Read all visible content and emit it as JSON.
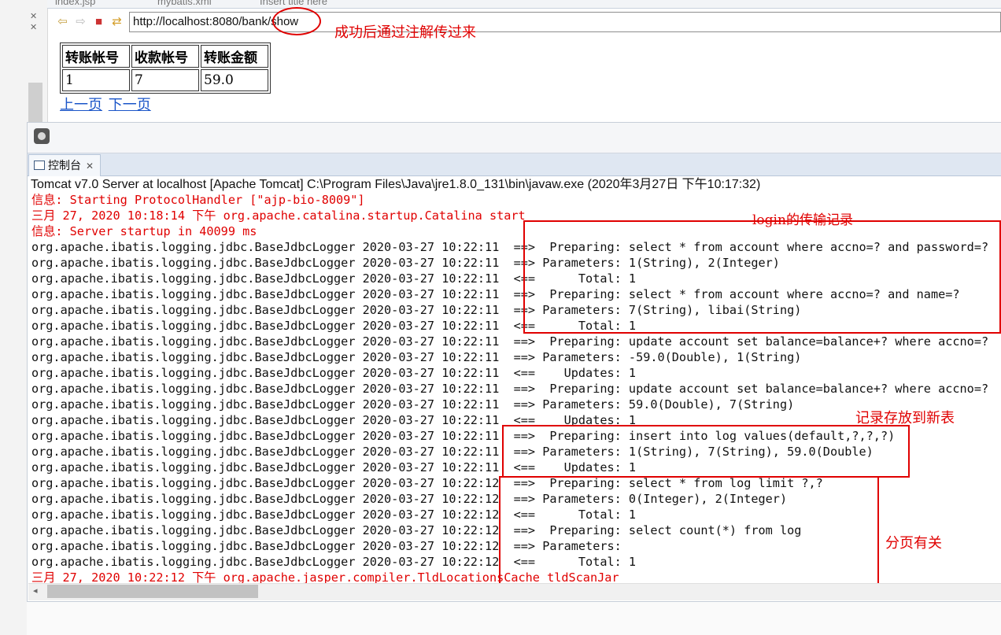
{
  "editor_tabs": [
    "index.jsp",
    "mybatis.xml",
    "Insert title here"
  ],
  "browser": {
    "url": "http://localhost:8080/bank/show",
    "url_note": "成功后通过注解传过来"
  },
  "page_table": {
    "headers": [
      "转账帐号",
      "收款帐号",
      "转账金额"
    ],
    "row": [
      "1",
      "7",
      "59.0"
    ]
  },
  "pager": {
    "prev": "上一页",
    "next": "下一页"
  },
  "console": {
    "tab_label": "控制台",
    "tab_close": "✕",
    "server_line": "Tomcat v7.0 Server at localhost [Apache Tomcat] C:\\Program Files\\Java\\jre1.8.0_131\\bin\\javaw.exe  (2020年3月27日 下午10:17:32)",
    "lines": [
      {
        "c": "red",
        "t": "信息: Starting ProtocolHandler [\"ajp-bio-8009\"]"
      },
      {
        "c": "red",
        "t": "三月 27, 2020 10:18:14 下午 org.apache.catalina.startup.Catalina start"
      },
      {
        "c": "red",
        "t": "信息: Server startup in 40099 ms"
      },
      {
        "c": "blk",
        "t": "org.apache.ibatis.logging.jdbc.BaseJdbcLogger 2020-03-27 10:22:11  ==>  Preparing: select * from account where accno=? and password=?"
      },
      {
        "c": "blk",
        "t": "org.apache.ibatis.logging.jdbc.BaseJdbcLogger 2020-03-27 10:22:11  ==> Parameters: 1(String), 2(Integer)"
      },
      {
        "c": "blk",
        "t": "org.apache.ibatis.logging.jdbc.BaseJdbcLogger 2020-03-27 10:22:11  <==      Total: 1"
      },
      {
        "c": "blk",
        "t": "org.apache.ibatis.logging.jdbc.BaseJdbcLogger 2020-03-27 10:22:11  ==>  Preparing: select * from account where accno=? and name=?"
      },
      {
        "c": "blk",
        "t": "org.apache.ibatis.logging.jdbc.BaseJdbcLogger 2020-03-27 10:22:11  ==> Parameters: 7(String), libai(String)"
      },
      {
        "c": "blk",
        "t": "org.apache.ibatis.logging.jdbc.BaseJdbcLogger 2020-03-27 10:22:11  <==      Total: 1"
      },
      {
        "c": "blk",
        "t": "org.apache.ibatis.logging.jdbc.BaseJdbcLogger 2020-03-27 10:22:11  ==>  Preparing: update account set balance=balance+? where accno=?"
      },
      {
        "c": "blk",
        "t": "org.apache.ibatis.logging.jdbc.BaseJdbcLogger 2020-03-27 10:22:11  ==> Parameters: -59.0(Double), 1(String)"
      },
      {
        "c": "blk",
        "t": "org.apache.ibatis.logging.jdbc.BaseJdbcLogger 2020-03-27 10:22:11  <==    Updates: 1"
      },
      {
        "c": "blk",
        "t": "org.apache.ibatis.logging.jdbc.BaseJdbcLogger 2020-03-27 10:22:11  ==>  Preparing: update account set balance=balance+? where accno=?"
      },
      {
        "c": "blk",
        "t": "org.apache.ibatis.logging.jdbc.BaseJdbcLogger 2020-03-27 10:22:11  ==> Parameters: 59.0(Double), 7(String)"
      },
      {
        "c": "blk",
        "t": "org.apache.ibatis.logging.jdbc.BaseJdbcLogger 2020-03-27 10:22:11  <==    Updates: 1"
      },
      {
        "c": "blk",
        "t": "org.apache.ibatis.logging.jdbc.BaseJdbcLogger 2020-03-27 10:22:11  ==>  Preparing: insert into log values(default,?,?,?)"
      },
      {
        "c": "blk",
        "t": "org.apache.ibatis.logging.jdbc.BaseJdbcLogger 2020-03-27 10:22:11  ==> Parameters: 1(String), 7(String), 59.0(Double)"
      },
      {
        "c": "blk",
        "t": "org.apache.ibatis.logging.jdbc.BaseJdbcLogger 2020-03-27 10:22:11  <==    Updates: 1"
      },
      {
        "c": "blk",
        "t": "org.apache.ibatis.logging.jdbc.BaseJdbcLogger 2020-03-27 10:22:12  ==>  Preparing: select * from log limit ?,?"
      },
      {
        "c": "blk",
        "t": "org.apache.ibatis.logging.jdbc.BaseJdbcLogger 2020-03-27 10:22:12  ==> Parameters: 0(Integer), 2(Integer)"
      },
      {
        "c": "blk",
        "t": "org.apache.ibatis.logging.jdbc.BaseJdbcLogger 2020-03-27 10:22:12  <==      Total: 1"
      },
      {
        "c": "blk",
        "t": "org.apache.ibatis.logging.jdbc.BaseJdbcLogger 2020-03-27 10:22:12  ==>  Preparing: select count(*) from log"
      },
      {
        "c": "blk",
        "t": "org.apache.ibatis.logging.jdbc.BaseJdbcLogger 2020-03-27 10:22:12  ==> Parameters: "
      },
      {
        "c": "blk",
        "t": "org.apache.ibatis.logging.jdbc.BaseJdbcLogger 2020-03-27 10:22:12  <==      Total: 1"
      },
      {
        "c": "red",
        "t": "三月 27, 2020 10:22:12 下午 org.apache.jasper.compiler.TldLocationsCache tldScanJar"
      }
    ]
  },
  "annotations": {
    "login": "login的传输记录",
    "new_table": "记录存放到新表",
    "paging": "分页有关"
  },
  "colors": {
    "annotation": "#e00000",
    "link": "#1a55c8",
    "log_red": "#e00000"
  }
}
